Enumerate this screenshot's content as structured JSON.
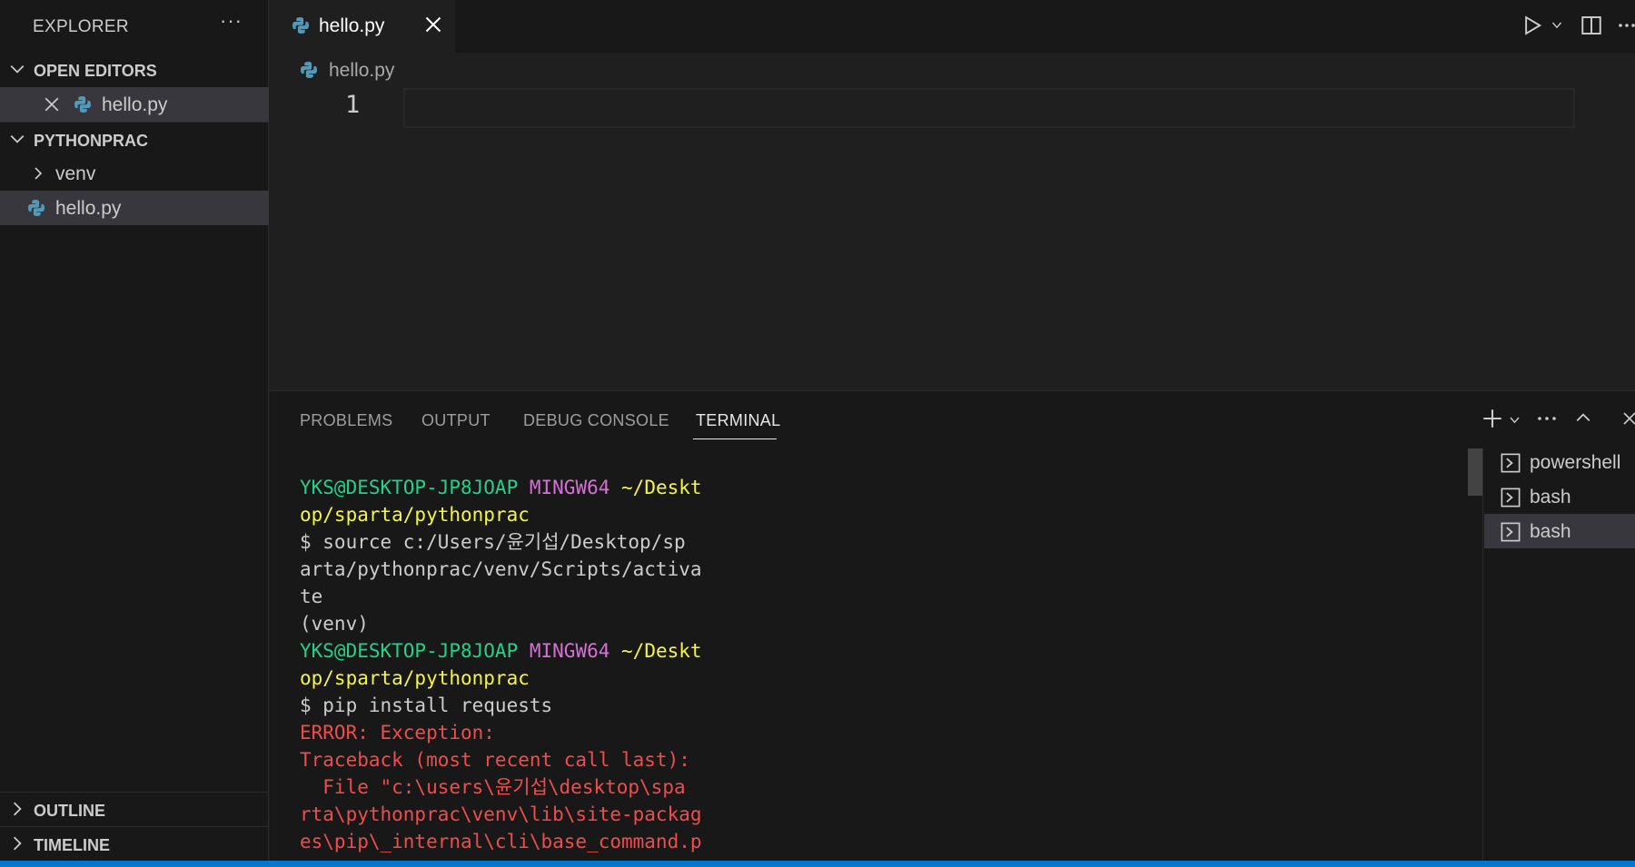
{
  "colors": {
    "accent": "#0078d4",
    "python_icon": "#519aba",
    "terminal_green": "#23d18b",
    "terminal_magenta": "#d670d6",
    "terminal_yellow": "#f5f543",
    "terminal_red": "#f14c4c"
  },
  "sidebar": {
    "title": "EXPLORER",
    "more_glyph": "···",
    "open_editors": {
      "label": "OPEN EDITORS",
      "items": [
        {
          "label": "hello.py",
          "icon": "python-icon"
        }
      ]
    },
    "workspace": {
      "label": "PYTHONPRAC",
      "items": [
        {
          "label": "venv",
          "type": "folder"
        },
        {
          "label": "hello.py",
          "type": "file",
          "icon": "python-icon"
        }
      ]
    },
    "outline_label": "OUTLINE",
    "timeline_label": "TIMELINE"
  },
  "editor": {
    "tab_label": "hello.py",
    "breadcrumb": "hello.py",
    "line_number": "1"
  },
  "panel": {
    "tabs": [
      "PROBLEMS",
      "OUTPUT",
      "DEBUG CONSOLE",
      "TERMINAL"
    ],
    "active_tab": "TERMINAL",
    "terminal_lines": [
      [
        {
          "t": "YKS@DESKTOP-JP8JOAP ",
          "c": "green"
        },
        {
          "t": "MINGW64 ",
          "c": "magenta"
        },
        {
          "t": "~/Deskt",
          "c": "yellow"
        }
      ],
      [
        {
          "t": "op/sparta/pythonprac",
          "c": "yellow"
        }
      ],
      [
        {
          "t": "$ source c:/Users/윤기섭/Desktop/sp",
          "c": "white"
        }
      ],
      [
        {
          "t": "arta/pythonprac/venv/Scripts/activa",
          "c": "white"
        }
      ],
      [
        {
          "t": "te",
          "c": "white"
        }
      ],
      [
        {
          "t": "(venv)",
          "c": "white"
        }
      ],
      [
        {
          "t": "YKS@DESKTOP-JP8JOAP ",
          "c": "green"
        },
        {
          "t": "MINGW64 ",
          "c": "magenta"
        },
        {
          "t": "~/Deskt",
          "c": "yellow"
        }
      ],
      [
        {
          "t": "op/sparta/pythonprac",
          "c": "yellow"
        }
      ],
      [
        {
          "t": "$ pip install requests",
          "c": "white"
        }
      ],
      [
        {
          "t": "ERROR: Exception:",
          "c": "red"
        }
      ],
      [
        {
          "t": "Traceback (most recent call last):",
          "c": "red"
        }
      ],
      [
        {
          "t": "  File \"c:\\users\\윤기섭\\desktop\\spa",
          "c": "red"
        }
      ],
      [
        {
          "t": "rta\\pythonprac\\venv\\lib\\site-packag",
          "c": "red"
        }
      ],
      [
        {
          "t": "es\\pip\\_internal\\cli\\base_command.p",
          "c": "red"
        }
      ]
    ],
    "terminals": [
      {
        "label": "powershell"
      },
      {
        "label": "bash"
      },
      {
        "label": "bash",
        "selected": true
      }
    ]
  }
}
